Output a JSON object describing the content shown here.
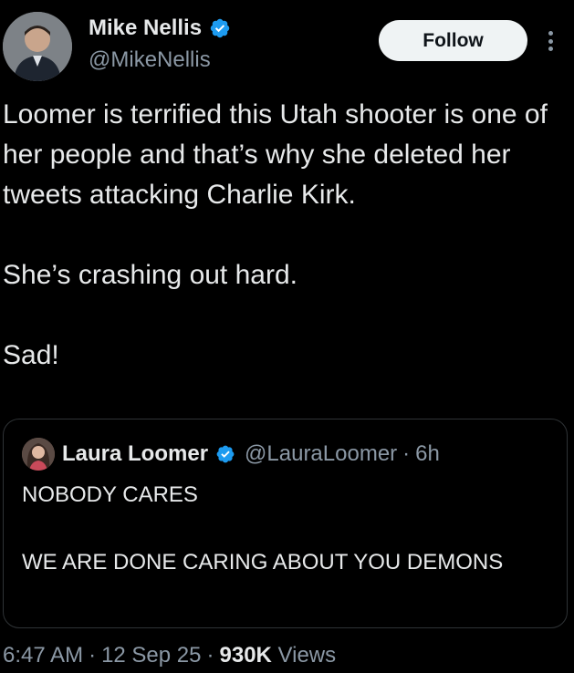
{
  "author": {
    "name": "Mike Nellis",
    "handle": "@MikeNellis",
    "verified_icon": "verified-badge-icon"
  },
  "actions": {
    "follow_label": "Follow",
    "more_icon": "more-options-icon"
  },
  "tweet": {
    "paragraphs": [
      "Loomer is terrified this Utah shooter is one of her people and that’s why she deleted her tweets attacking Charlie Kirk.",
      "She’s crashing out hard.",
      "Sad!"
    ]
  },
  "quoted_tweet": {
    "name": "Laura Loomer",
    "handle": "@LauraLoomer",
    "separator": "·",
    "time": "6h",
    "paragraphs": [
      "NOBODY CARES",
      "WE ARE DONE CARING ABOUT YOU DEMONS"
    ]
  },
  "meta": {
    "time": "6:47 AM",
    "separator": "·",
    "date": "12 Sep 25",
    "views_count": "930K",
    "views_label": "Views"
  },
  "colors": {
    "background": "#000000",
    "text_primary": "#e7e9ea",
    "text_secondary": "#8b98a5",
    "verified_blue": "#1d9bf0",
    "border": "#2f3336",
    "follow_bg": "#eff3f4"
  }
}
